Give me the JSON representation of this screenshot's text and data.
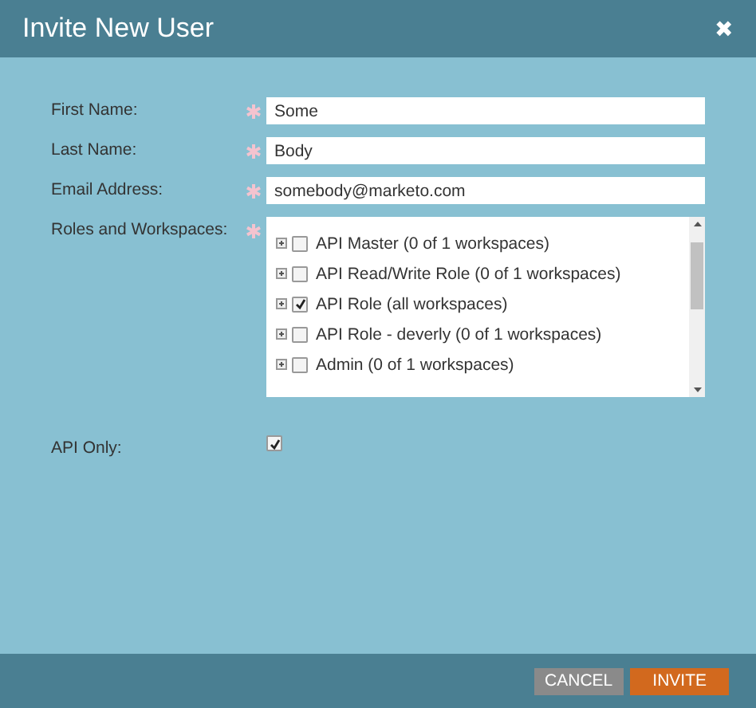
{
  "window": {
    "title": "Invite New User",
    "close": "✖"
  },
  "fields": [
    {
      "label": "First Name:",
      "required": true,
      "value": "Some"
    },
    {
      "label": "Last Name:",
      "required": true,
      "value": "Body"
    },
    {
      "label": "Email Address:",
      "required": true,
      "value": "somebody@marketo.com"
    }
  ],
  "roles": {
    "label": "Roles and Workspaces:",
    "required": true,
    "items": [
      {
        "name": "API Master (0 of 1 workspaces)",
        "checked": false
      },
      {
        "name": "API Read/Write Role (0 of 1 workspaces)",
        "checked": false
      },
      {
        "name": "API Role (all workspaces)",
        "checked": true
      },
      {
        "name": "API Role - deverly (0 of 1 workspaces)",
        "checked": false
      },
      {
        "name": "Admin (0 of 1 workspaces)",
        "checked": false
      }
    ]
  },
  "api_only": {
    "label": "API Only:",
    "checked": true
  },
  "buttons": [
    {
      "label": "CANCEL",
      "kind": "secondary"
    },
    {
      "label": "INVITE",
      "kind": "primary"
    }
  ]
}
